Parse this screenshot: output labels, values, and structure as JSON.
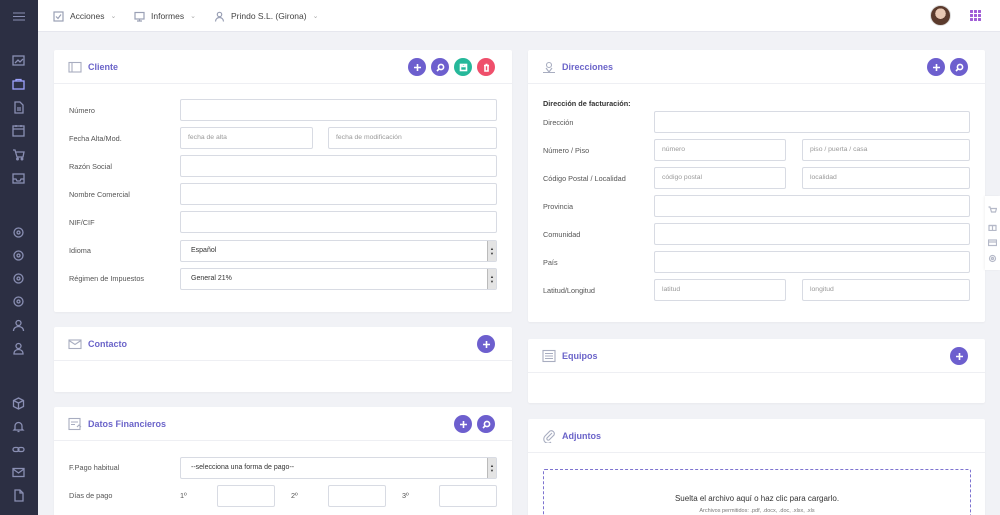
{
  "topbar": {
    "acciones": "Acciones",
    "informes": "Informes",
    "company": "Prindo S.L. (Girona)"
  },
  "cliente": {
    "title": "Cliente",
    "numero_label": "Número",
    "fecha_label": "Fecha Alta/Mod.",
    "fecha_alta_placeholder": "fecha de alta",
    "fecha_mod_placeholder": "fecha de modificación",
    "razon_label": "Razón Social",
    "nombre_label": "Nombre Comercial",
    "nif_label": "NIF/CIF",
    "idioma_label": "Idioma",
    "idioma_value": "Español",
    "regimen_label": "Régimen de Impuestos",
    "regimen_value": "General 21%"
  },
  "contacto": {
    "title": "Contacto"
  },
  "financieros": {
    "title": "Datos Financieros",
    "fpago_label": "F.Pago habitual",
    "fpago_value": "--selecciona una forma de pago--",
    "dias_label": "Días de pago",
    "dia1": "1º",
    "dia2": "2º",
    "dia3": "3º"
  },
  "direcciones": {
    "title": "Direcciones",
    "subhead": "Dirección de facturación:",
    "direccion_label": "Dirección",
    "numero_label": "Número / Piso",
    "numero_placeholder": "número",
    "piso_placeholder": "piso / puerta / casa",
    "cp_label": "Código Postal / Localidad",
    "cp_placeholder": "código postal",
    "localidad_placeholder": "localidad",
    "provincia_label": "Provincia",
    "comunidad_label": "Comunidad",
    "pais_label": "País",
    "latlon_label": "Latitud/Longitud",
    "latitud_placeholder": "latitud",
    "longitud_placeholder": "longitud"
  },
  "equipos": {
    "title": "Equipos"
  },
  "adjuntos": {
    "title": "Adjuntos",
    "drop_text": "Suelta el archivo aquí o haz clic para cargarlo.",
    "drop_sub": "Archivos permitidos: .pdf, .docx, .doc, .xlsx, .xls"
  },
  "icons": {
    "menu": "hamburger-icon",
    "add": "plus-icon",
    "search": "search-icon",
    "save": "save-icon",
    "delete": "trash-icon"
  },
  "colors": {
    "accent": "#6b64c9",
    "button_purple": "#6d5fce",
    "button_teal": "#26b89a",
    "button_red": "#ef4f6b",
    "sidebar": "#2c2f43"
  }
}
